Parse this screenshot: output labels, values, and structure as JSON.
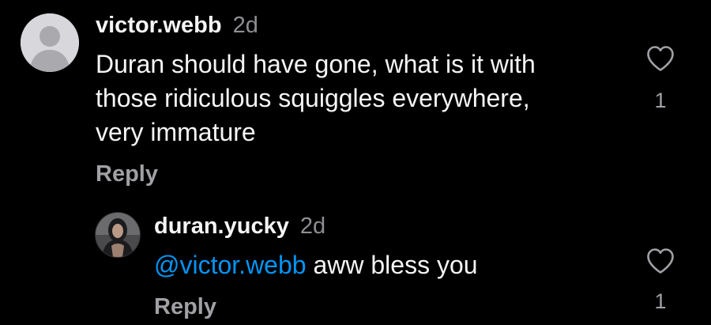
{
  "comments": [
    {
      "username": "victor.webb",
      "timestamp": "2d",
      "text": "Duran should have gone, what is it with those ridiculous squiggles everywhere, very immature",
      "reply_label": "Reply",
      "like_count": "1",
      "avatar": "default-avatar-icon"
    },
    {
      "username": "duran.yucky",
      "timestamp": "2d",
      "mention": "@victor.webb",
      "text": " aww bless you",
      "reply_label": "Reply",
      "like_count": "1",
      "avatar": "profile-photo"
    }
  ],
  "colors": {
    "background": "#000000",
    "text": "#f5f5f5",
    "muted": "#8e8e93",
    "mention": "#0095f6"
  }
}
